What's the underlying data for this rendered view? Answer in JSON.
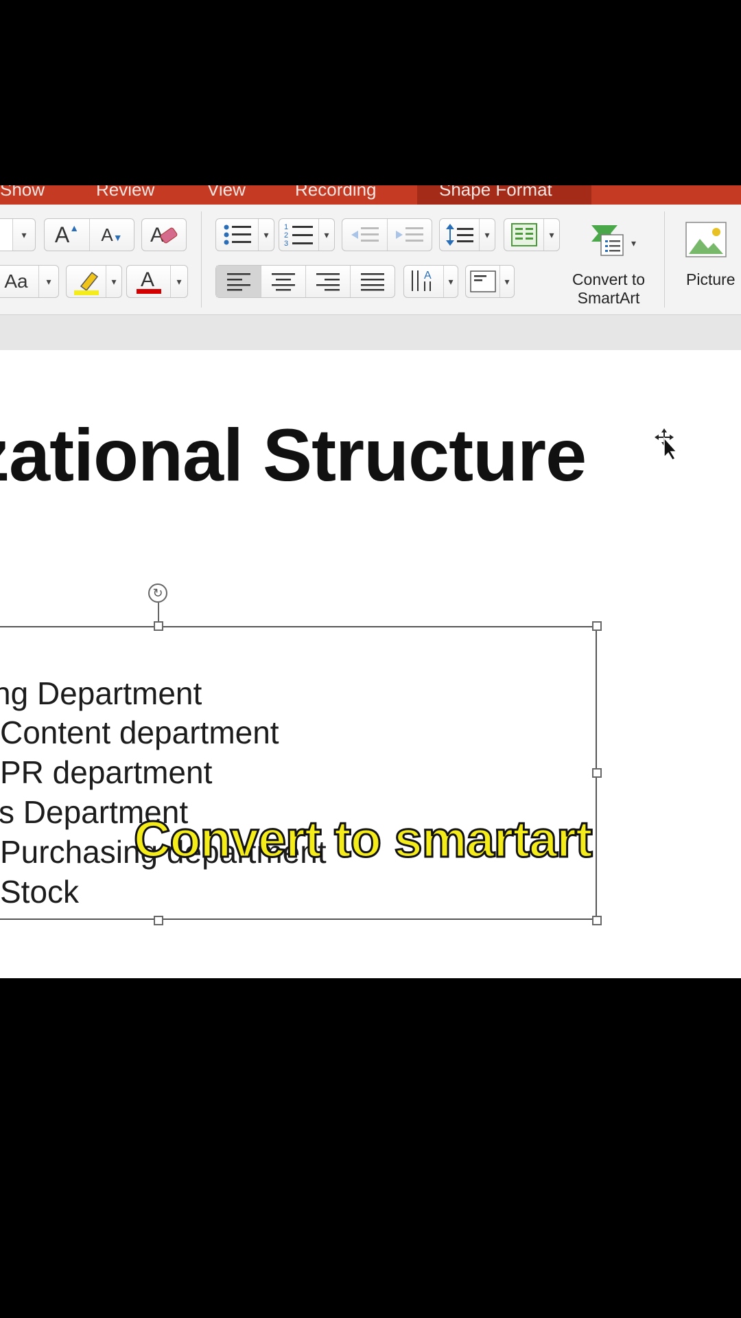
{
  "ribbon_tabs": [
    "Show",
    "Review",
    "View",
    "Recording",
    "Shape Format"
  ],
  "active_tab": "Shape Format",
  "font_size_value": "",
  "buttons": {
    "convert_smartart_label": "Convert to\nSmartArt",
    "convert_smartart_line1": "Convert to",
    "convert_smartart_line2": "SmartArt",
    "picture_label": "Picture"
  },
  "slide": {
    "title": "zational Structure",
    "list_items": [
      "ng Department",
      "Content department",
      "PR department",
      "s Department",
      "Purchasing department",
      "Stock"
    ]
  },
  "caption": "Convert to smartart",
  "colors": {
    "tab_bar": "#c43a23",
    "highlight": "#f5ec1c",
    "font_color": "#d40000",
    "caption": "#f5ec1c"
  }
}
